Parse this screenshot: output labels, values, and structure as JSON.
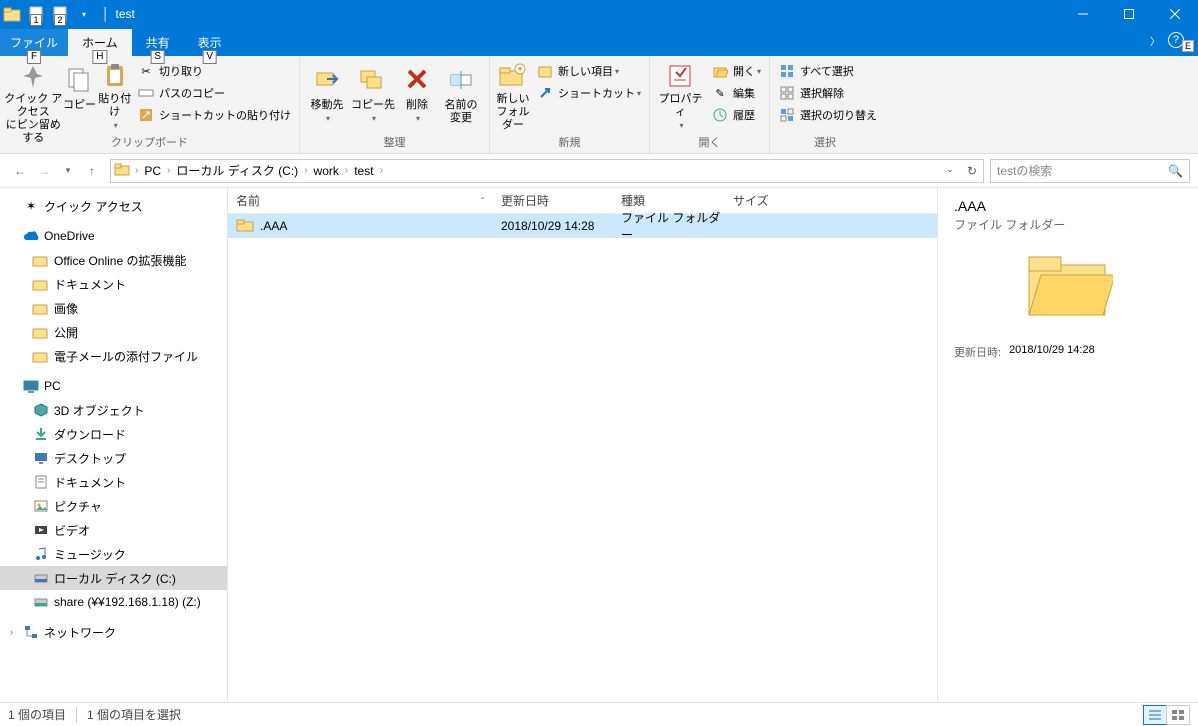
{
  "title": "test",
  "quick_access_badges": [
    "1",
    "2"
  ],
  "tabs": {
    "file": "ファイル",
    "file_key": "F",
    "home": "ホーム",
    "home_key": "H",
    "share": "共有",
    "share_key": "S",
    "view": "表示",
    "view_key": "V"
  },
  "help_side": "E",
  "ribbon": {
    "clipboard": {
      "pin": "クイック アクセス\nにピン留めする",
      "copy": "コピー",
      "paste": "貼り付け",
      "cut": "切り取り",
      "copypath": "パスのコピー",
      "pasteshortcut": "ショートカットの貼り付け",
      "label": "クリップボード"
    },
    "organize": {
      "moveto": "移動先",
      "copyto": "コピー先",
      "delete": "削除",
      "rename": "名前の\n変更",
      "label": "整理"
    },
    "new": {
      "newfolder": "新しい\nフォルダー",
      "newitem": "新しい項目",
      "shortcut": "ショートカット",
      "label": "新規"
    },
    "open": {
      "properties": "プロパティ",
      "open": "開く",
      "edit": "編集",
      "history": "履歴",
      "label": "開く"
    },
    "select": {
      "all": "すべて選択",
      "none": "選択解除",
      "invert": "選択の切り替え",
      "label": "選択"
    }
  },
  "breadcrumbs": [
    "PC",
    "ローカル ディスク (C:)",
    "work",
    "test"
  ],
  "search_placeholder": "testの検索",
  "columns": {
    "name": "名前",
    "modified": "更新日時",
    "type": "種類",
    "size": "サイズ"
  },
  "rows": [
    {
      "name": ".AAA",
      "modified": "2018/10/29 14:28",
      "type": "ファイル フォルダー",
      "size": ""
    }
  ],
  "navpane": {
    "quick": "クイック アクセス",
    "onedrive": "OneDrive",
    "od_items": [
      "Office Online の拡張機能",
      "ドキュメント",
      "画像",
      "公開",
      "電子メールの添付ファイル"
    ],
    "pc": "PC",
    "pc_items": [
      "3D オブジェクト",
      "ダウンロード",
      "デスクトップ",
      "ドキュメント",
      "ピクチャ",
      "ビデオ",
      "ミュージック",
      "ローカル ディスク (C:)",
      "share (¥¥192.168.1.18) (Z:)"
    ],
    "network": "ネットワーク"
  },
  "preview": {
    "name": ".AAA",
    "type": "ファイル フォルダー",
    "modified_label": "更新日時:",
    "modified": "2018/10/29 14:28"
  },
  "status": {
    "count": "1 個の項目",
    "selected": "1 個の項目を選択"
  }
}
